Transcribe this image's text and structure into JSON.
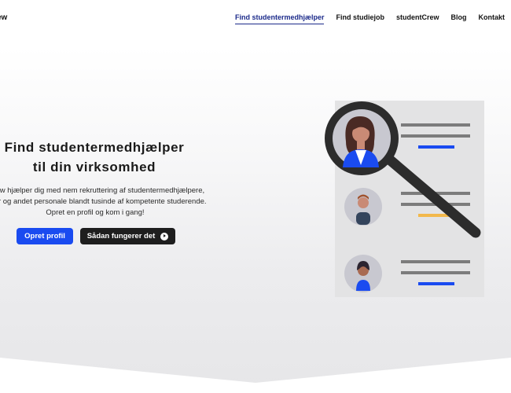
{
  "nav": {
    "logo": "ew",
    "items": [
      {
        "label": "Find studentermedhjælper",
        "active": true
      },
      {
        "label": "Find studiejob",
        "active": false
      },
      {
        "label": "studentCrew",
        "active": false
      },
      {
        "label": "Blog",
        "active": false
      },
      {
        "label": "Kontakt",
        "active": false
      }
    ]
  },
  "hero": {
    "title_line1": "Find studentermedhjælper",
    "title_line2": "til din virksomhed",
    "text_line1": "tCrew hjælper dig med nem rekruttering af studentermedhjælpere,",
    "text_line2": "anter og andet personale blandt tusinde af kompetente studerende.",
    "text_line3": "Opret en profil og kom i gang!",
    "primary_button": "Opret profil",
    "secondary_button": "Sådan fungerer det"
  },
  "colors": {
    "accent": "#1a4bf0",
    "nav_active": "#1b2a8a",
    "dark_button": "#1e1e1e",
    "highlight_yellow": "#f2b84b"
  },
  "icons": {
    "play": "play-circle-icon",
    "illustration": "magnifier-search-profiles-illustration"
  }
}
